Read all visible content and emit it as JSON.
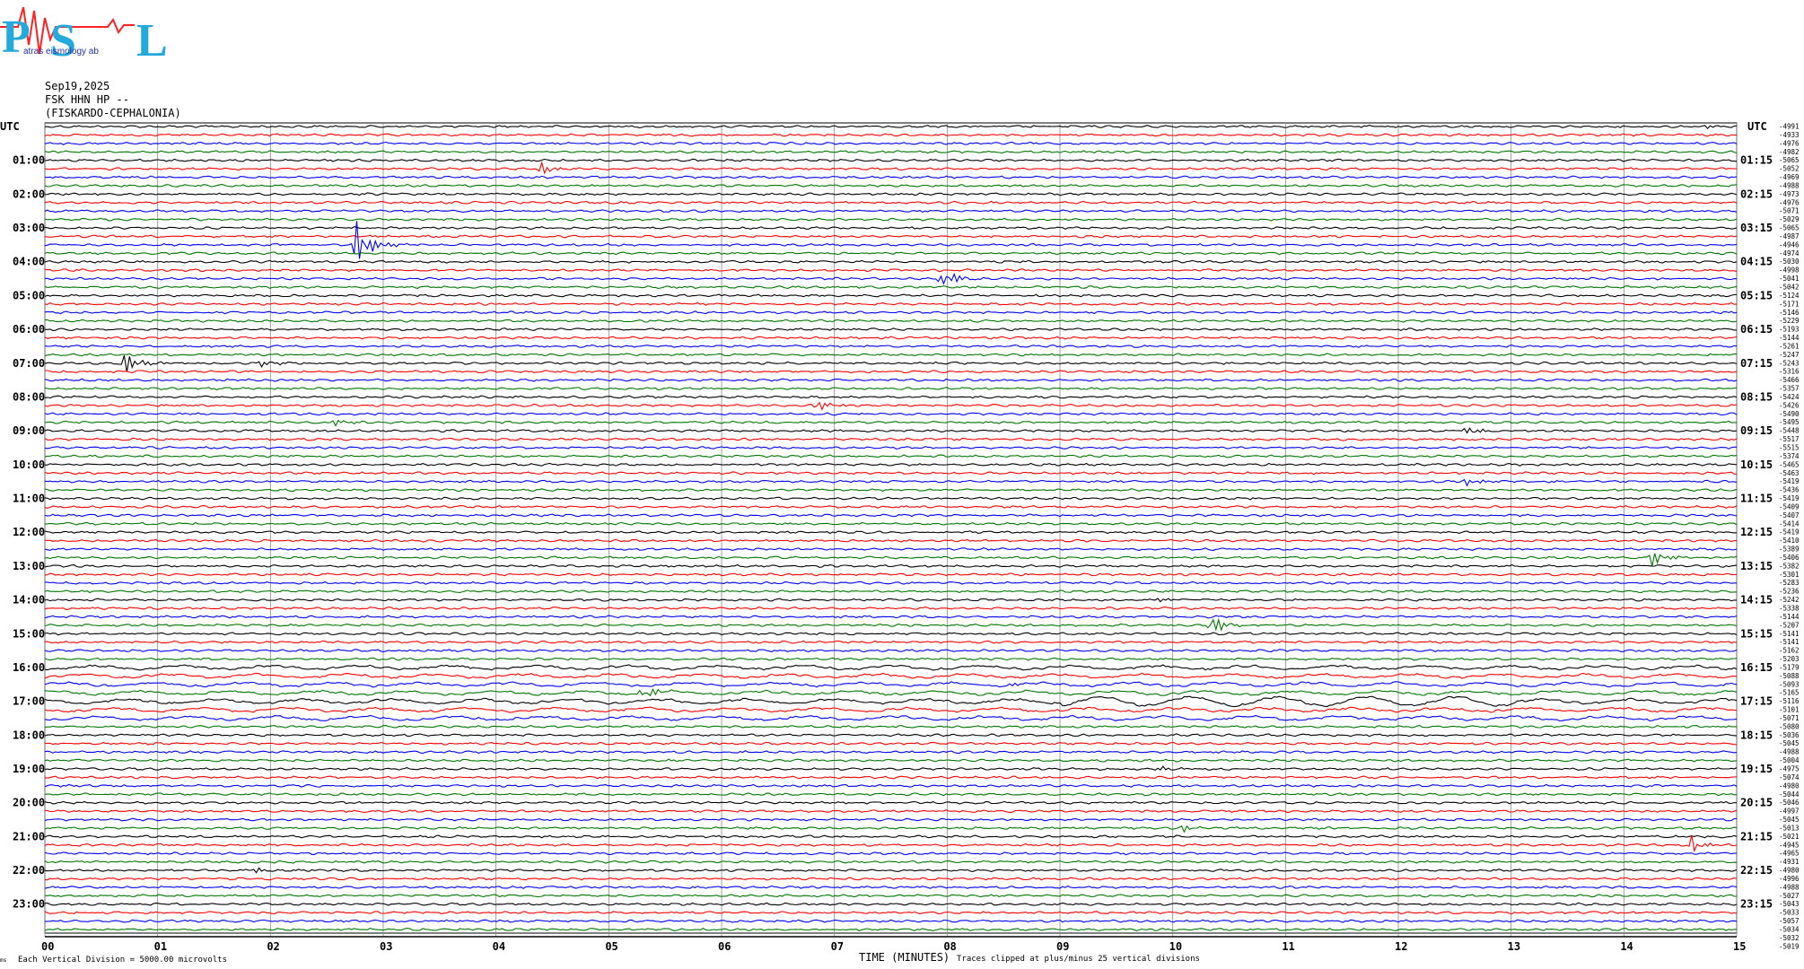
{
  "header": {
    "date": "Sep19,2025",
    "channel": "FSK HHN HP --",
    "station": "(FISKARDO-CEPHALONIA)"
  },
  "logo": {
    "letters": "PSL",
    "subtitle": "atras  eismology  ab"
  },
  "footer": {
    "division_note": "Each Vertical Division = 5000.00 microvolts",
    "xlabel": "TIME (MINUTES)",
    "clip_note": "Traces clipped at plus/minus 25 vertical divisions",
    "corner": "ms"
  },
  "chart_data": {
    "type": "line",
    "title": "",
    "xlabel": "TIME (MINUTES)",
    "ylabel": "UTC",
    "x_ticks": [
      "00",
      "01",
      "02",
      "03",
      "04",
      "05",
      "06",
      "07",
      "08",
      "09",
      "10",
      "11",
      "12",
      "13",
      "14",
      "15"
    ],
    "xlim": [
      0,
      15
    ],
    "left_labels": [
      "UTC",
      "01:00",
      "02:00",
      "03:00",
      "04:00",
      "05:00",
      "06:00",
      "07:00",
      "08:00",
      "09:00",
      "10:00",
      "11:00",
      "12:00",
      "13:00",
      "14:00",
      "15:00",
      "16:00",
      "17:00",
      "18:00",
      "19:00",
      "20:00",
      "21:00",
      "22:00",
      "23:00"
    ],
    "right_labels": [
      "UTC",
      "01:15",
      "02:15",
      "03:15",
      "04:15",
      "05:15",
      "06:15",
      "07:15",
      "08:15",
      "09:15",
      "10:15",
      "11:15",
      "12:15",
      "13:15",
      "14:15",
      "15:15",
      "16:15",
      "17:15",
      "18:15",
      "19:15",
      "20:15",
      "21:15",
      "22:15",
      "23:15"
    ],
    "trace_offsets": [
      "-4991",
      "-4933",
      "-4976",
      "-4982",
      "-5065",
      "-5052",
      "-4969",
      "-4988",
      "-4973",
      "-4976",
      "-5071",
      "-5029",
      "-5065",
      "-4987",
      "-4946",
      "-4974",
      "-5030",
      "-4998",
      "-5041",
      "-5042",
      "-5124",
      "-5171",
      "-5146",
      "-5229",
      "-5193",
      "-5144",
      "-5261",
      "-5247",
      "-5243",
      "-5316",
      "-5466",
      "-5357",
      "-5424",
      "-5426",
      "-5490",
      "-5495",
      "-5448",
      "-5517",
      "-5515",
      "-5374",
      "-5465",
      "-5463",
      "-5419",
      "-5436",
      "-5419",
      "-5409",
      "-5407",
      "-5414",
      "-5419",
      "-5410",
      "-5389",
      "-5406",
      "-5382",
      "-5301",
      "-5283",
      "-5236",
      "-5242",
      "-5338",
      "-5144",
      "-5207",
      "-5141",
      "-5141",
      "-5162",
      "-5203",
      "-5179",
      "-5088",
      "-5093",
      "-5165",
      "-5116",
      "-5101",
      "-5071",
      "-5080",
      "-5036",
      "-5045",
      "-4988",
      "-5004",
      "-4975",
      "-5074",
      "-4980",
      "-5044",
      "-5046",
      "-4997",
      "-5045",
      "-5013",
      "-5021",
      "-4945",
      "-4965",
      "-4931",
      "-4980",
      "-4996",
      "-4988",
      "-5027",
      "-5043",
      "-5033",
      "-5057",
      "-5034",
      "-5032",
      "-5019"
    ],
    "colors": [
      "#000000",
      "#ff0000",
      "#0000ff",
      "#007700"
    ],
    "trace_count": 96,
    "minutes_per_trace": 15,
    "events": [
      {
        "trace": 0,
        "minute": 14.7,
        "amp": 0.6
      },
      {
        "trace": 5,
        "minute": 4.4,
        "amp": 1.3
      },
      {
        "trace": 14,
        "minute": 2.75,
        "amp": 5.5
      },
      {
        "trace": 18,
        "minute": 7.95,
        "amp": 2.2
      },
      {
        "trace": 28,
        "minute": 0.68,
        "amp": 2.8
      },
      {
        "trace": 28,
        "minute": 1.92,
        "amp": 0.7
      },
      {
        "trace": 33,
        "minute": 6.82,
        "amp": 1.6
      },
      {
        "trace": 35,
        "minute": 2.55,
        "amp": 0.7
      },
      {
        "trace": 36,
        "minute": 12.6,
        "amp": 0.8
      },
      {
        "trace": 42,
        "minute": 12.6,
        "amp": 0.9
      },
      {
        "trace": 51,
        "minute": 14.25,
        "amp": 1.8
      },
      {
        "trace": 56,
        "minute": 9.85,
        "amp": 0.6
      },
      {
        "trace": 59,
        "minute": 10.32,
        "amp": 3.2
      },
      {
        "trace": 66,
        "minute": 8.5,
        "amp": 0.5
      },
      {
        "trace": 67,
        "minute": 5.3,
        "amp": 1.8
      },
      {
        "trace": 76,
        "minute": 9.85,
        "amp": 0.5
      },
      {
        "trace": 83,
        "minute": 10.1,
        "amp": 0.8
      },
      {
        "trace": 85,
        "minute": 14.6,
        "amp": 1.6
      },
      {
        "trace": 88,
        "minute": 1.85,
        "amp": 0.7
      }
    ]
  }
}
